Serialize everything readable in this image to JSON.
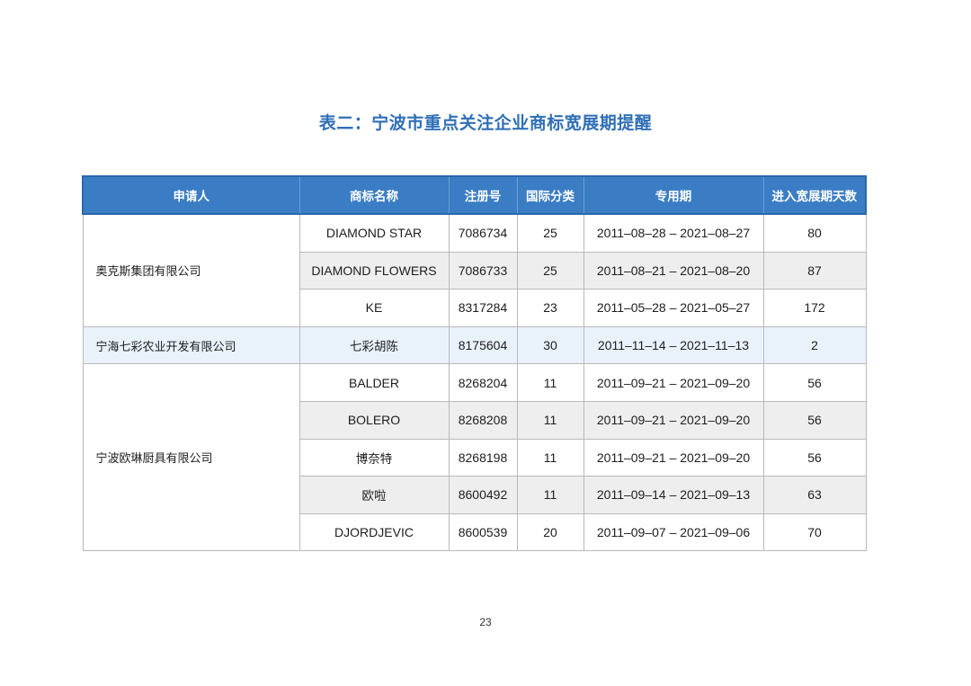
{
  "title": "表二：宁波市重点关注企业商标宽展期提醒",
  "headers": [
    "申请人",
    "商标名称",
    "注册号",
    "国际分类",
    "专用期",
    "进入宽展期天数"
  ],
  "groups": [
    {
      "applicant": "奥克斯集团有限公司",
      "rows": [
        {
          "mark": "DIAMOND STAR",
          "reg_no": "7086734",
          "class": "25",
          "period": "2011–08–28 – 2021–08–27",
          "days": "80"
        },
        {
          "mark": "DIAMOND FLOWERS",
          "reg_no": "7086733",
          "class": "25",
          "period": "2011–08–21 – 2021–08–20",
          "days": "87"
        },
        {
          "mark": "KE",
          "reg_no": "8317284",
          "class": "23",
          "period": "2011–05–28 – 2021–05–27",
          "days": "172"
        }
      ]
    },
    {
      "applicant": "宁海七彩农业开发有限公司",
      "rows": [
        {
          "mark": "七彩胡陈",
          "reg_no": "8175604",
          "class": "30",
          "period": "2011–11–14 – 2021–11–13",
          "days": "2"
        }
      ]
    },
    {
      "applicant": "宁波欧琳厨具有限公司",
      "rows": [
        {
          "mark": "BALDER",
          "reg_no": "8268204",
          "class": "11",
          "period": "2011–09–21 – 2021–09–20",
          "days": "56"
        },
        {
          "mark": "BOLERO",
          "reg_no": "8268208",
          "class": "11",
          "period": "2011–09–21 – 2021–09–20",
          "days": "56"
        },
        {
          "mark": "博奈特",
          "reg_no": "8268198",
          "class": "11",
          "period": "2011–09–21 – 2021–09–20",
          "days": "56"
        },
        {
          "mark": "欧啦",
          "reg_no": "8600492",
          "class": "11",
          "period": "2011–09–14 – 2021–09–13",
          "days": "63"
        },
        {
          "mark": "DJORDJEVIC",
          "reg_no": "8600539",
          "class": "20",
          "period": "2011–09–07 – 2021–09–06",
          "days": "70"
        }
      ]
    }
  ],
  "page_number": "23"
}
